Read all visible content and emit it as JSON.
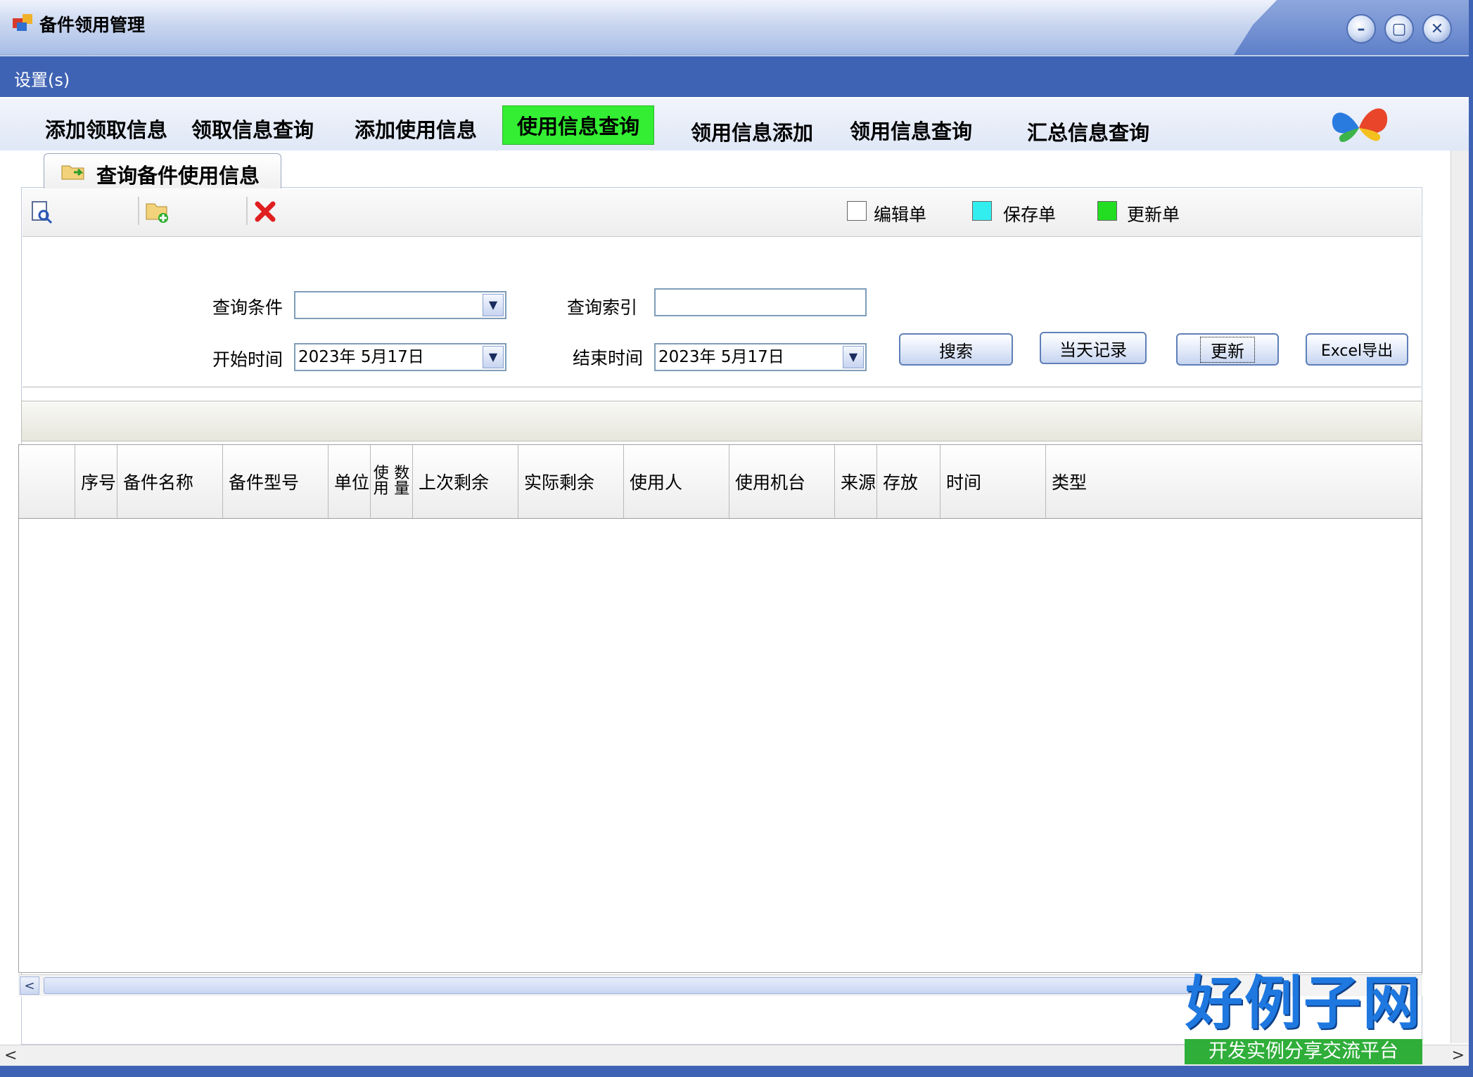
{
  "window": {
    "title": "备件领用管理",
    "controls": {
      "minimize": "–",
      "restore": "▢",
      "close": "✕"
    }
  },
  "menu": {
    "settings": "设置(s)"
  },
  "top_tabs": [
    {
      "label": "添加领取信息",
      "active": false
    },
    {
      "label": "领取信息查询",
      "active": false
    },
    {
      "label": "添加使用信息",
      "active": false
    },
    {
      "label": "使用信息查询",
      "active": true
    },
    {
      "label": "领用信息添加",
      "active": false
    },
    {
      "label": "领用信息查询",
      "active": false
    },
    {
      "label": "汇总信息查询",
      "active": false
    }
  ],
  "inner_tab": {
    "label": "查询备件使用信息",
    "icon": "folder-arrow-icon"
  },
  "toolbar": {
    "icons": [
      "preview-icon",
      "add-folder-icon",
      "delete-icon"
    ],
    "legend": [
      {
        "label": "编辑单",
        "color": "#ffffff"
      },
      {
        "label": "保存单",
        "color": "#33eeee"
      },
      {
        "label": "更新单",
        "color": "#22dd22"
      }
    ]
  },
  "query": {
    "condition_label": "查询条件",
    "condition_value": "",
    "index_label": "查询索引",
    "index_value": "",
    "start_label": "开始时间",
    "start_value": "2023年 5月17日",
    "end_label": "结束时间",
    "end_value": "2023年 5月17日",
    "buttons": {
      "search": "搜索",
      "today": "当天记录",
      "update": "更新",
      "export": "Excel导出"
    }
  },
  "grid": {
    "columns": [
      "序号",
      "备件名称",
      "备件型号",
      "单位",
      "使用数量",
      "上次剩余",
      "实际剩余",
      "使用人",
      "使用机台",
      "来源",
      "存放",
      "时间",
      "类型"
    ],
    "small_column_lines": [
      "使用",
      "数量"
    ],
    "rows": []
  },
  "scroll": {
    "left": "<",
    "right": ">",
    "up": "<"
  },
  "site_mark": {
    "title": "好例子网",
    "subtitle": "开发实例分享交流平台"
  }
}
